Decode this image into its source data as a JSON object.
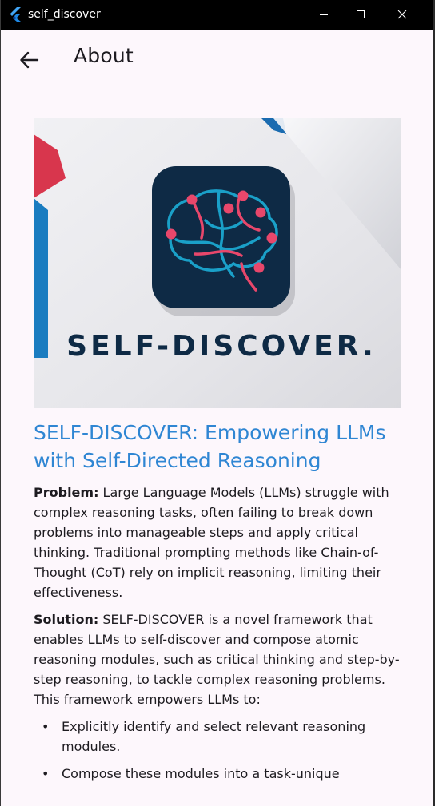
{
  "window": {
    "title": "self_discover"
  },
  "appbar": {
    "title": "About"
  },
  "hero": {
    "brand_text": "SELF-DISCOVER."
  },
  "article": {
    "heading": "SELF-DISCOVER: Empowering LLMs with Self-Directed Reasoning",
    "problem_label": "Problem:",
    "problem_text": " Large Language Models (LLMs) struggle with complex reasoning tasks, often failing to break down problems into manageable steps and apply critical thinking. Traditional prompting methods like Chain-of-Thought (CoT) rely on implicit reasoning, limiting their effectiveness.",
    "solution_label": "Solution:",
    "solution_text": " SELF-DISCOVER is a novel framework that enables LLMs to self-discover and compose atomic reasoning modules, such as critical thinking and step-by-step reasoning, to tackle complex reasoning problems. This framework empowers LLMs to:",
    "bullets": [
      "Explicitly identify and select relevant reasoning modules.",
      "Compose these modules into a task-unique"
    ],
    "bullet_char": "•"
  },
  "colors": {
    "heading": "#2f86d3",
    "background": "#fdf7fc",
    "icon_tile": "#0e2a45",
    "brain_pink": "#e8476b",
    "brain_blue": "#1aa0c8"
  }
}
